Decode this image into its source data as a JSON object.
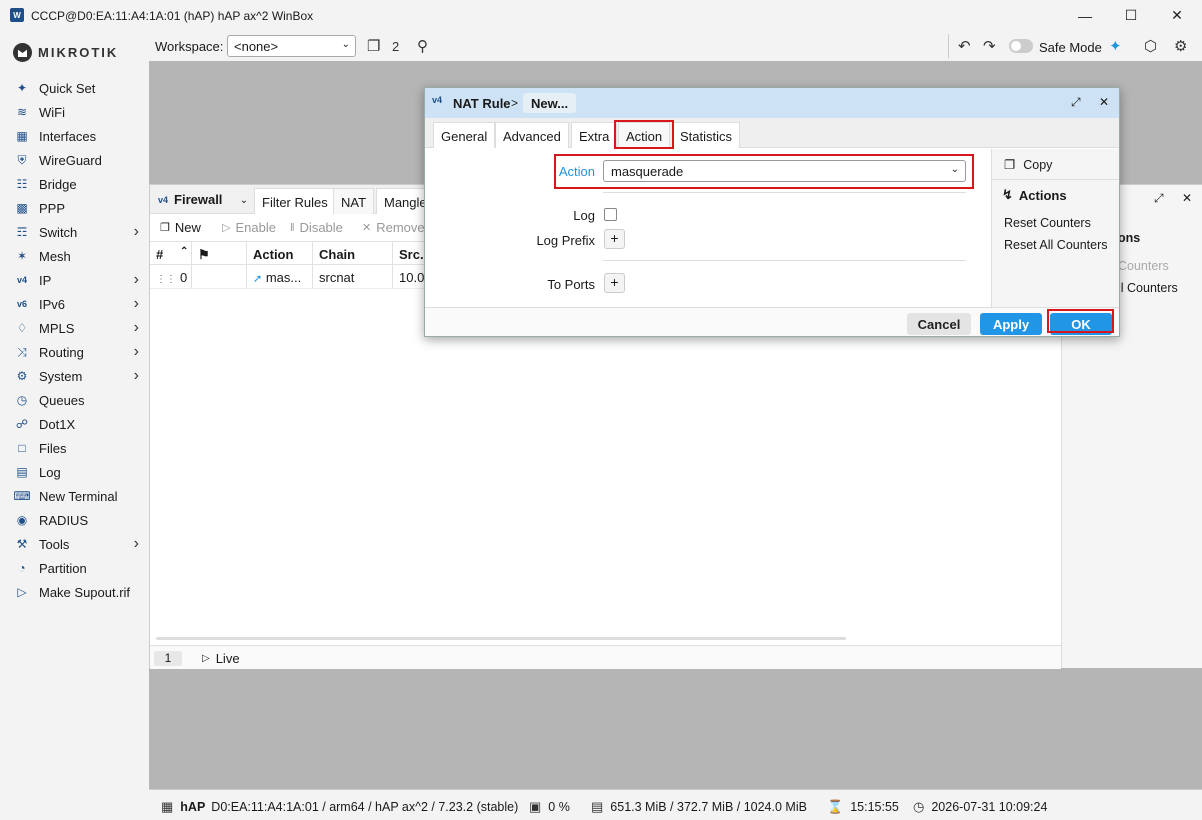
{
  "window": {
    "title": "CCCP@D0:EA:11:A4:1A:01 (hAP) hAP ax^2 WinBox",
    "app_icon": "winbox-icon"
  },
  "brand": {
    "logo_text": "MIKROTIK"
  },
  "sidebar": {
    "items": [
      {
        "label": "Quick Set",
        "icon": "wand-icon",
        "submenu": false
      },
      {
        "label": "WiFi",
        "icon": "wifi-icon",
        "submenu": false
      },
      {
        "label": "Interfaces",
        "icon": "interfaces-icon",
        "submenu": false
      },
      {
        "label": "WireGuard",
        "icon": "shield-icon",
        "submenu": false
      },
      {
        "label": "Bridge",
        "icon": "bridge-icon",
        "submenu": false
      },
      {
        "label": "PPP",
        "icon": "ppp-icon",
        "submenu": false
      },
      {
        "label": "Switch",
        "icon": "switch-icon",
        "submenu": true
      },
      {
        "label": "Mesh",
        "icon": "mesh-icon",
        "submenu": false
      },
      {
        "label": "IP",
        "icon": "ip-icon",
        "submenu": true
      },
      {
        "label": "IPv6",
        "icon": "ipv6-icon",
        "submenu": true
      },
      {
        "label": "MPLS",
        "icon": "tag-icon",
        "submenu": true
      },
      {
        "label": "Routing",
        "icon": "routing-icon",
        "submenu": true
      },
      {
        "label": "System",
        "icon": "gear-icon",
        "submenu": true
      },
      {
        "label": "Queues",
        "icon": "queues-icon",
        "submenu": false
      },
      {
        "label": "Dot1X",
        "icon": "dot1x-icon",
        "submenu": false
      },
      {
        "label": "Files",
        "icon": "files-icon",
        "submenu": false
      },
      {
        "label": "Log",
        "icon": "log-icon",
        "submenu": false
      },
      {
        "label": "New Terminal",
        "icon": "terminal-icon",
        "submenu": false
      },
      {
        "label": "RADIUS",
        "icon": "radius-icon",
        "submenu": false
      },
      {
        "label": "Tools",
        "icon": "tools-icon",
        "submenu": true
      },
      {
        "label": "Partition",
        "icon": "partition-icon",
        "submenu": false
      },
      {
        "label": "Make Supout.rif",
        "icon": "supout-icon",
        "submenu": false
      }
    ]
  },
  "toolbar": {
    "workspace_label": "Workspace:",
    "workspace_value": "<none>",
    "windows_count": "2",
    "safe_mode_label": "Safe Mode"
  },
  "firewall": {
    "title": "Firewall",
    "tabs": [
      "Filter Rules",
      "NAT",
      "Mangle"
    ],
    "active_tab": "NAT",
    "actions": {
      "new": "New",
      "enable": "Enable",
      "disable": "Disable",
      "remove": "Remove"
    },
    "columns": [
      "#",
      "Action",
      "Chain",
      "Src."
    ],
    "rows": [
      {
        "num": "0",
        "action": "mas...",
        "chain": "srcnat",
        "src": "10.0"
      }
    ],
    "status": {
      "count": "1",
      "live": "Live"
    },
    "right_panel": {
      "title_partial": "ons",
      "item1": "Counters",
      "item2": "ll Counters"
    }
  },
  "nat_dialog": {
    "title": "NAT Rule",
    "separator": ">",
    "subtitle": "New...",
    "tabs": [
      "General",
      "Advanced",
      "Extra",
      "Action",
      "Statistics"
    ],
    "active_tab": "Action",
    "fields": {
      "action_label": "Action",
      "action_value": "masquerade",
      "log_label": "Log",
      "log_checked": false,
      "log_prefix_label": "Log Prefix",
      "to_ports_label": "To Ports"
    },
    "side": {
      "copy": "Copy",
      "actions_header": "Actions",
      "reset_counters": "Reset Counters",
      "reset_all_counters": "Reset All Counters"
    },
    "buttons": {
      "cancel": "Cancel",
      "apply": "Apply",
      "ok": "OK"
    },
    "highlight_color": "#d9161c",
    "accent_color": "#2196e6"
  },
  "statusbar": {
    "device": "hAP",
    "info": "D0:EA:11:A4:1A:01 / arm64 / hAP ax^2 / 7.23.2 (stable)",
    "cpu": "0 %",
    "memory": "651.3 MiB / 372.7 MiB / 1024.0 MiB",
    "uptime": "15:15:55",
    "datetime": "2026-07-31 10:09:24"
  }
}
